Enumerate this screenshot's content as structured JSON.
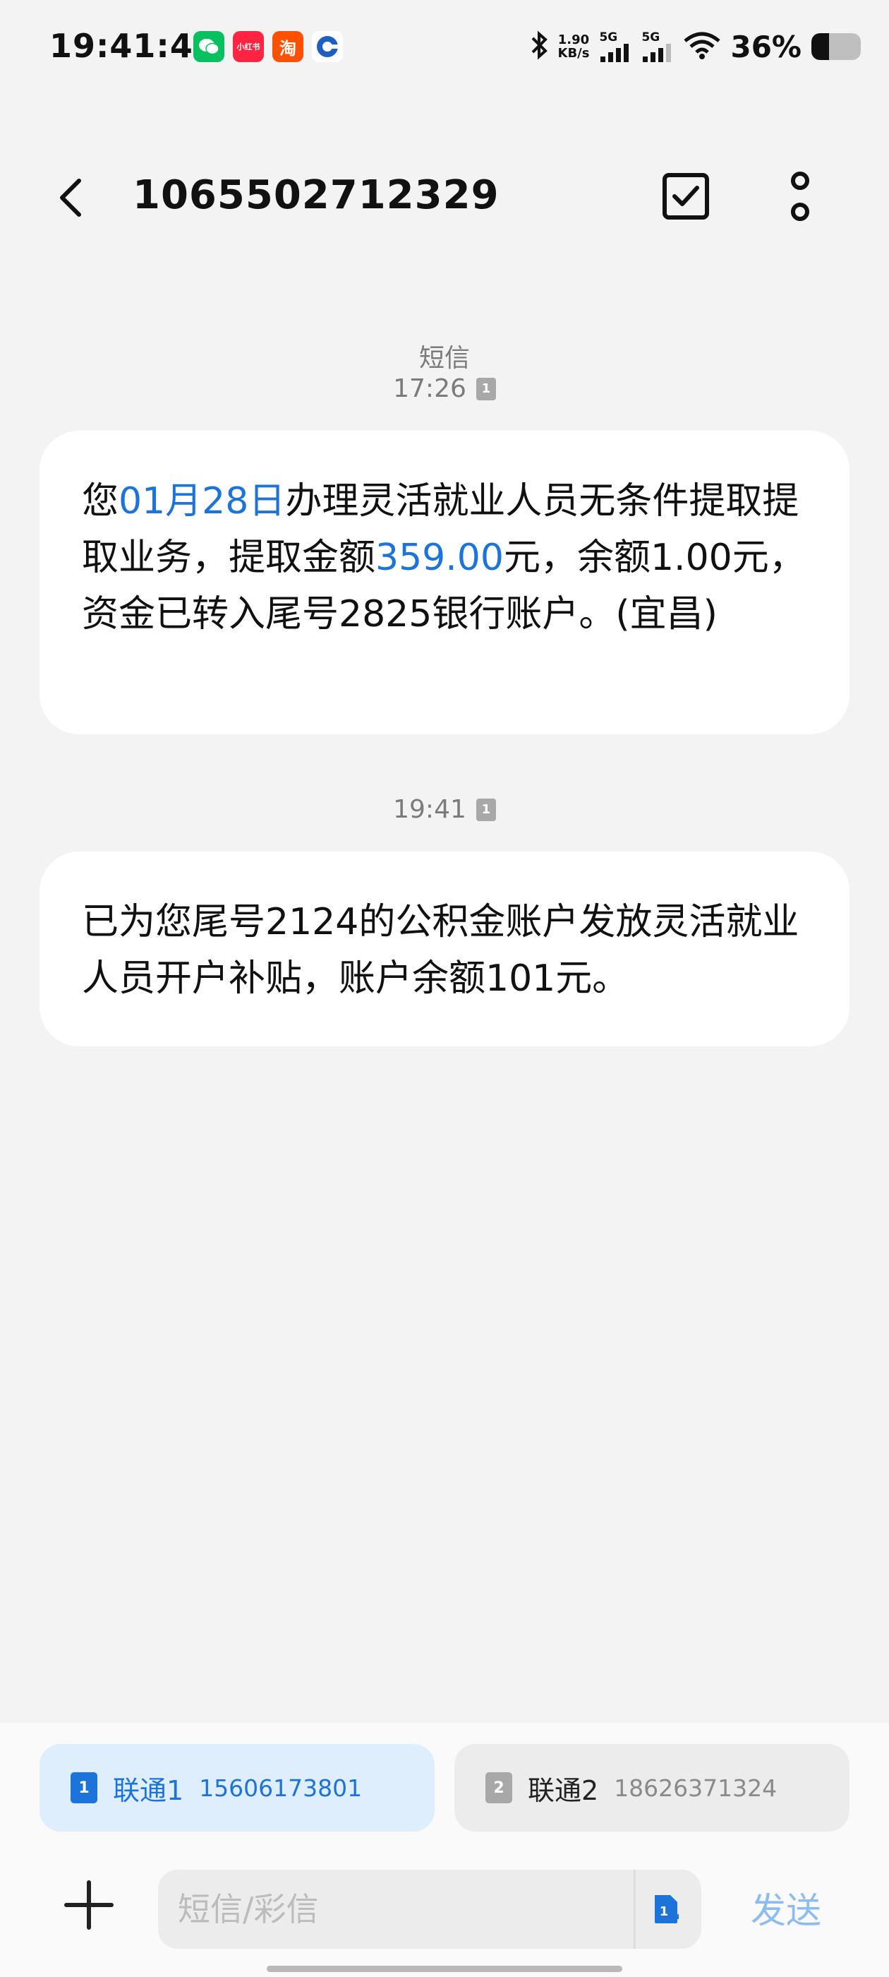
{
  "status_bar": {
    "time": "19:41:44",
    "apps": [
      {
        "icon": "wechat-icon",
        "color": "#07c160",
        "text": ""
      },
      {
        "icon": "xiaohongshu-icon",
        "color": "#ff2442",
        "text": "小红书"
      },
      {
        "icon": "taobao-icon",
        "color": "#ff5000",
        "text": "淘"
      },
      {
        "icon": "bank-icon",
        "color": "#1d5fc3",
        "text": ""
      }
    ],
    "net_speed_value": "1.90",
    "net_speed_unit": "KB/s",
    "sim1_network": "5G",
    "sim2_network": "5G",
    "battery_percent_text": "36%",
    "battery_level": 0.36
  },
  "header": {
    "title": "1065502712329"
  },
  "messages": [
    {
      "channel_label": "短信",
      "time": "17:26",
      "sim": "1",
      "segments": [
        {
          "text": "您",
          "highlight": false
        },
        {
          "text": "01月28日",
          "highlight": true
        },
        {
          "text": "办理灵活就业人员无条件提取提取业务，提取金额",
          "highlight": false
        },
        {
          "text": "359.00",
          "highlight": true
        },
        {
          "text": "元，余额1.00元，资金已转入尾号2825银行账户。(宜昌)",
          "highlight": false
        }
      ]
    },
    {
      "time": "19:41",
      "sim": "1",
      "segments": [
        {
          "text": "已为您尾号2124的公积金账户发放灵活就业人员开户补贴，账户余额101元。",
          "highlight": false
        }
      ]
    }
  ],
  "sim_selector": {
    "sim1": {
      "index": "1",
      "name": "联通1",
      "number": "15606173801"
    },
    "sim2": {
      "index": "2",
      "name": "联通2",
      "number": "18626371324"
    }
  },
  "composer": {
    "placeholder": "短信/彩信",
    "value": "",
    "send_label": "发送"
  },
  "colors": {
    "accent": "#1c73d9",
    "send_disabled": "#8dbcf0",
    "sim1_bg": "#dfeefd",
    "sim2_bg": "#ececec"
  }
}
